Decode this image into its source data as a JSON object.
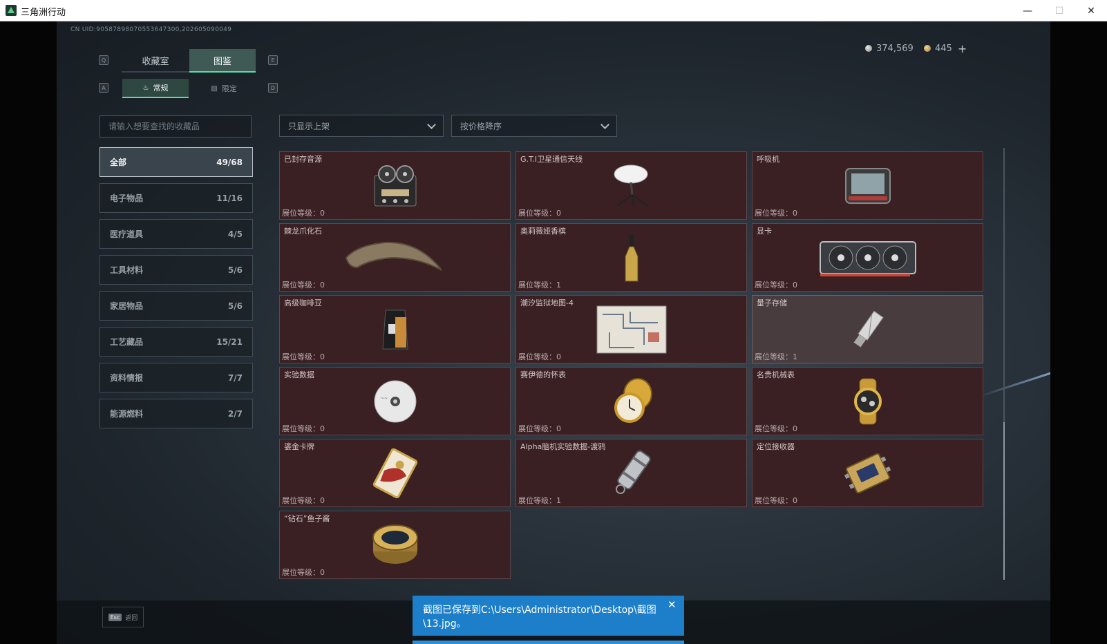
{
  "window": {
    "title": "三角洲行动",
    "minimize": "—",
    "maximize": "☐",
    "close": "✕"
  },
  "uid": "CN UID:90587898070553647300,202605090049",
  "currency": {
    "silver": "374,569",
    "gold": "445",
    "plus": "+"
  },
  "tabs": {
    "key_left": "Q",
    "key_right": "E",
    "items": [
      {
        "label": "收藏室"
      },
      {
        "label": "图鉴"
      }
    ],
    "active": 1
  },
  "subtabs": {
    "key_left": "A",
    "key_right": "D",
    "items": [
      {
        "label": "常规"
      },
      {
        "label": "限定"
      }
    ],
    "active": 0
  },
  "search": {
    "placeholder": "请输入想要查找的收藏品"
  },
  "filters": {
    "shelf": "只显示上架",
    "sort": "按价格降序"
  },
  "categories": [
    {
      "label": "全部",
      "count": "49/68"
    },
    {
      "label": "电子物品",
      "count": "11/16"
    },
    {
      "label": "医疗道具",
      "count": "4/5"
    },
    {
      "label": "工具材料",
      "count": "5/6"
    },
    {
      "label": "家居物品",
      "count": "5/6"
    },
    {
      "label": "工艺藏品",
      "count": "15/21"
    },
    {
      "label": "资料情报",
      "count": "7/7"
    },
    {
      "label": "能源燃料",
      "count": "2/7"
    }
  ],
  "level_prefix": "展位等级：",
  "items": [
    {
      "name": "已封存音源",
      "level": "0",
      "icon": "tape-recorder-icon"
    },
    {
      "name": "G.T.I卫星通信天线",
      "level": "0",
      "icon": "satellite-dish-icon"
    },
    {
      "name": "呼吸机",
      "level": "0",
      "icon": "ventilator-icon"
    },
    {
      "name": "棘龙爪化石",
      "level": "0",
      "icon": "claw-fossil-icon"
    },
    {
      "name": "奥莉薇娅香槟",
      "level": "1",
      "icon": "champagne-bottle-icon"
    },
    {
      "name": "显卡",
      "level": "0",
      "icon": "graphics-card-icon"
    },
    {
      "name": "高级咖啡豆",
      "level": "0",
      "icon": "coffee-bag-icon"
    },
    {
      "name": "潮汐监狱地图-4",
      "level": "0",
      "icon": "map-icon"
    },
    {
      "name": "量子存储",
      "level": "1",
      "icon": "usb-drive-icon"
    },
    {
      "name": "实验数据",
      "level": "0",
      "icon": "disc-icon"
    },
    {
      "name": "赛伊德的怀表",
      "level": "0",
      "icon": "pocket-watch-icon"
    },
    {
      "name": "名贵机械表",
      "level": "0",
      "icon": "wristwatch-icon"
    },
    {
      "name": "鎏金卡牌",
      "level": "0",
      "icon": "gold-card-icon"
    },
    {
      "name": "Alpha脑机实验数据-渡鸦",
      "level": "1",
      "icon": "data-canister-icon"
    },
    {
      "name": "定位接收器",
      "level": "0",
      "icon": "receiver-icon"
    },
    {
      "name": "“钻石”鱼子酱",
      "level": "0",
      "icon": "caviar-tin-icon"
    }
  ],
  "footer": {
    "esc_key": "Esc",
    "back": "返回"
  },
  "toast": {
    "message": "截图已保存到C:\\Users\\Administrator\\Desktop\\截图\\13.jpg。",
    "close": "✕"
  }
}
